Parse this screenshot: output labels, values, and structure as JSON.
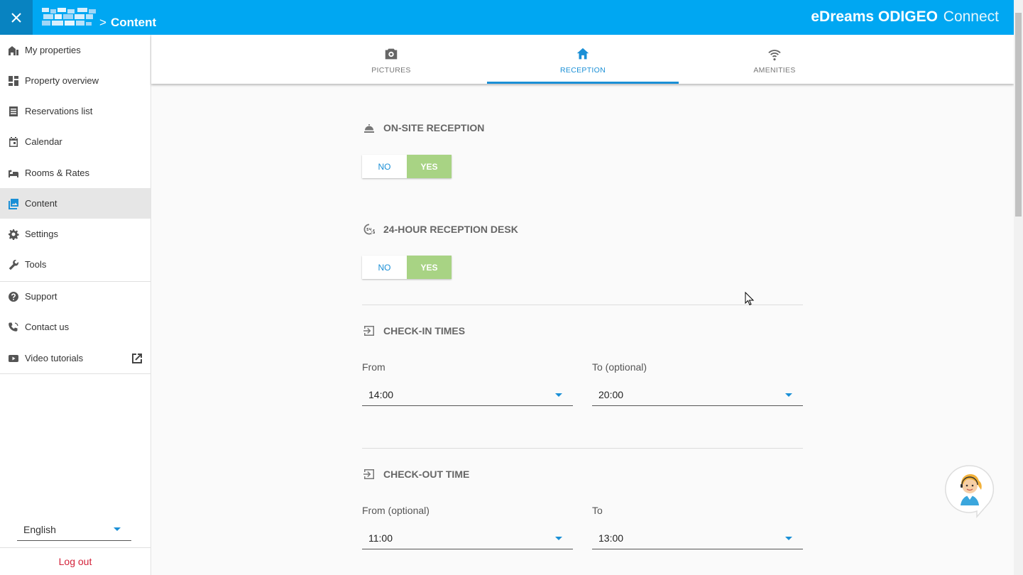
{
  "header": {
    "close_label": "close",
    "breadcrumb_current": "Content",
    "breadcrumb_sep": ">",
    "brand_bold": "eDreams ODIGEO",
    "brand_light": "Connect"
  },
  "sidebar": {
    "items": [
      {
        "label": "My properties",
        "icon": "buildings-icon"
      },
      {
        "label": "Property overview",
        "icon": "dashboard-icon"
      },
      {
        "label": "Reservations list",
        "icon": "list-icon"
      },
      {
        "label": "Calendar",
        "icon": "calendar-icon"
      },
      {
        "label": "Rooms & Rates",
        "icon": "bed-icon"
      },
      {
        "label": "Content",
        "icon": "image-icon",
        "active": true
      },
      {
        "label": "Settings",
        "icon": "gear-icon"
      },
      {
        "label": "Tools",
        "icon": "wrench-icon"
      },
      {
        "label": "Support",
        "icon": "help-icon"
      },
      {
        "label": "Contact us",
        "icon": "phone-icon"
      },
      {
        "label": "Video tutorials",
        "icon": "youtube-icon"
      }
    ],
    "language": "English",
    "logout": "Log out"
  },
  "tabs": [
    {
      "label": "PICTURES",
      "icon": "camera-icon"
    },
    {
      "label": "RECEPTION",
      "icon": "home-icon",
      "active": true
    },
    {
      "label": "AMENITIES",
      "icon": "wifi-icon"
    }
  ],
  "reception": {
    "onsite": {
      "title": "ON-SITE RECEPTION",
      "no": "NO",
      "yes": "YES",
      "selected": "YES"
    },
    "desk24": {
      "title": "24-HOUR RECEPTION DESK",
      "no": "NO",
      "yes": "YES",
      "selected": "YES"
    },
    "checkin": {
      "title": "CHECK-IN TIMES",
      "from_label": "From",
      "from_value": "14:00",
      "to_label": "To (optional)",
      "to_value": "20:00"
    },
    "checkout": {
      "title": "CHECK-OUT TIME",
      "from_label": "From (optional)",
      "from_value": "11:00",
      "to_label": "To",
      "to_value": "13:00"
    }
  },
  "colors": {
    "header": "#00a7f2",
    "accent": "#1a8fd6",
    "yes": "#a8d384",
    "logout": "#d3233a"
  }
}
